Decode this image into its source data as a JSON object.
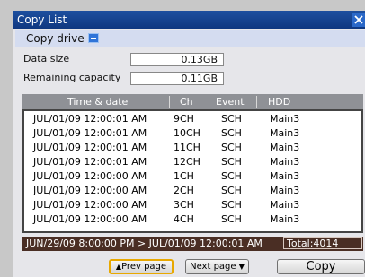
{
  "window": {
    "title": "Copy List",
    "copy_drive_label": "Copy drive",
    "copy_drive_icon": "drive-icon"
  },
  "info": {
    "data_size_label": "Data size",
    "data_size_value": "0.13GB",
    "remaining_label": "Remaining capacity",
    "remaining_value": "0.11GB"
  },
  "table": {
    "columns": [
      "Time & date",
      "Ch",
      "Event",
      "HDD"
    ],
    "rows": [
      {
        "time": "JUL/01/09 12:00:01 AM",
        "ch": "9CH",
        "event": "SCH",
        "hdd": "Main3"
      },
      {
        "time": "JUL/01/09 12:00:01 AM",
        "ch": "10CH",
        "event": "SCH",
        "hdd": "Main3"
      },
      {
        "time": "JUL/01/09 12:00:01 AM",
        "ch": "11CH",
        "event": "SCH",
        "hdd": "Main3"
      },
      {
        "time": "JUL/01/09 12:00:01 AM",
        "ch": "12CH",
        "event": "SCH",
        "hdd": "Main3"
      },
      {
        "time": "JUL/01/09 12:00:00 AM",
        "ch": "1CH",
        "event": "SCH",
        "hdd": "Main3"
      },
      {
        "time": "JUL/01/09 12:00:00 AM",
        "ch": "2CH",
        "event": "SCH",
        "hdd": "Main3"
      },
      {
        "time": "JUL/01/09 12:00:00 AM",
        "ch": "3CH",
        "event": "SCH",
        "hdd": "Main3"
      },
      {
        "time": "JUL/01/09 12:00:00 AM",
        "ch": "4CH",
        "event": "SCH",
        "hdd": "Main3"
      }
    ]
  },
  "status": {
    "range": "JUN/29/09  8:00:00 PM > JUL/01/09 12:00:01 AM",
    "total": "Total:4014"
  },
  "buttons": {
    "prev_label": "Prev page",
    "next_label": "Next page",
    "copy_label": "Copy"
  },
  "colors": {
    "title_bar": "#1d4f9f",
    "status_bar": "#4a2e24",
    "selected_outline": "#e8a800"
  }
}
